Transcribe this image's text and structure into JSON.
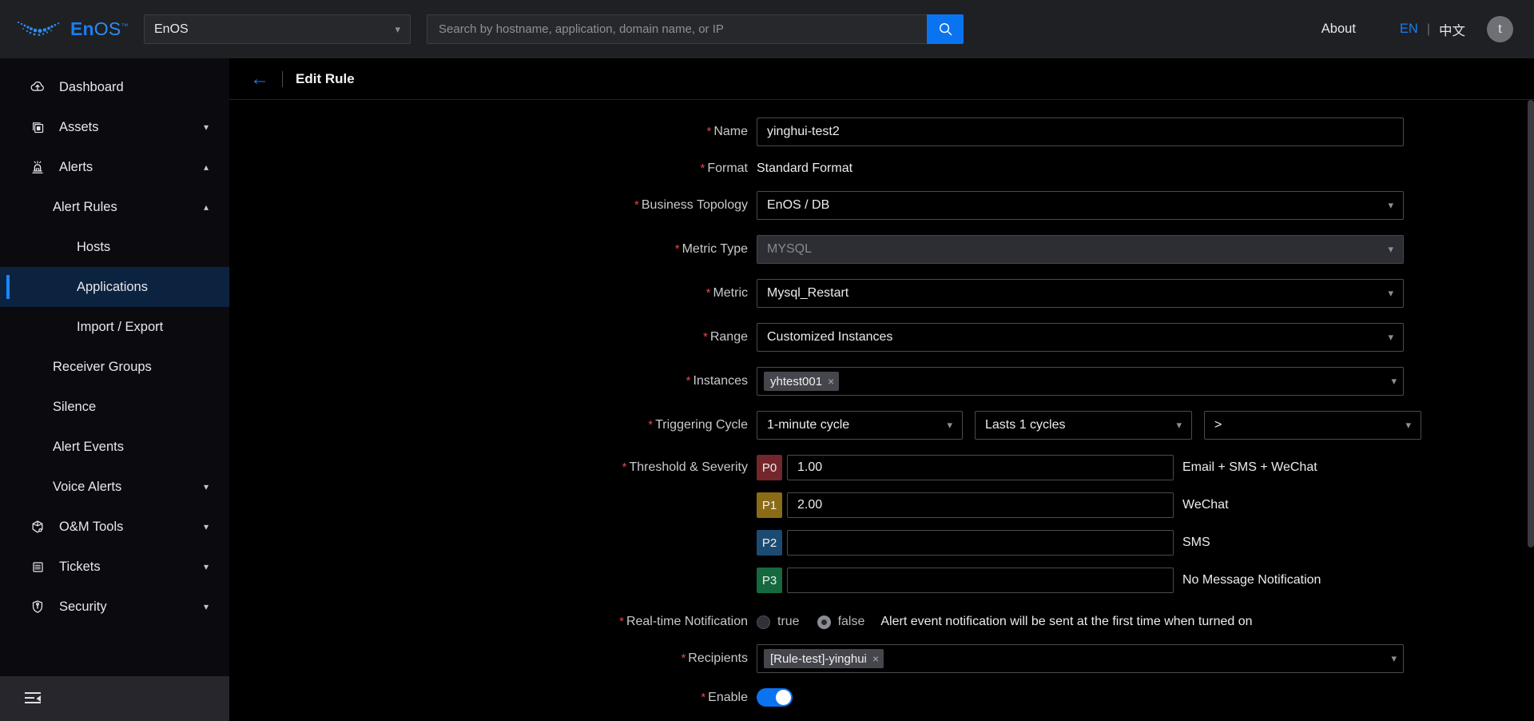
{
  "header": {
    "brand_main": "En",
    "brand_rest": "OS",
    "brand_tm": "™",
    "tenant_value": "EnOS",
    "search_placeholder": "Search by hostname, application, domain name, or IP",
    "search_value": "",
    "about_label": "About",
    "lang_en": "EN",
    "lang_separator": "|",
    "lang_cn": "中文",
    "avatar_initial": "t",
    "accent_color": "#0a74f0"
  },
  "sidebar": {
    "items": [
      {
        "label": "Dashboard",
        "icon": "cloud-dashboard-icon",
        "level": 1,
        "chevron": "",
        "active": false
      },
      {
        "label": "Assets",
        "icon": "assets-icon",
        "level": 1,
        "chevron": "˅",
        "active": false
      },
      {
        "label": "Alerts",
        "icon": "alerts-bell-icon",
        "level": 1,
        "chevron": "˄",
        "active": false
      },
      {
        "label": "Alert Rules",
        "icon": "",
        "level": 2,
        "chevron": "˄",
        "active": false
      },
      {
        "label": "Hosts",
        "icon": "",
        "level": 3,
        "chevron": "",
        "active": false
      },
      {
        "label": "Applications",
        "icon": "",
        "level": 3,
        "chevron": "",
        "active": true
      },
      {
        "label": "Import / Export",
        "icon": "",
        "level": 3,
        "chevron": "",
        "active": false
      },
      {
        "label": "Receiver Groups",
        "icon": "",
        "level": 2,
        "chevron": "",
        "active": false
      },
      {
        "label": "Silence",
        "icon": "",
        "level": 2,
        "chevron": "",
        "active": false
      },
      {
        "label": "Alert Events",
        "icon": "",
        "level": 2,
        "chevron": "",
        "active": false
      },
      {
        "label": "Voice Alerts",
        "icon": "",
        "level": 2,
        "chevron": "˅",
        "active": false
      },
      {
        "label": "O&M Tools",
        "icon": "om-tools-icon",
        "level": 1,
        "chevron": "˅",
        "active": false
      },
      {
        "label": "Tickets",
        "icon": "tickets-icon",
        "level": 1,
        "chevron": "˅",
        "active": false
      },
      {
        "label": "Security",
        "icon": "shield-icon",
        "level": 1,
        "chevron": "˅",
        "active": false
      }
    ],
    "collapse_icon": "menu-collapse-icon",
    "active_accent": "#1a87ff",
    "active_bg": "#0c2340"
  },
  "page": {
    "back_icon": "back-arrow-icon",
    "title": "Edit Rule"
  },
  "form": {
    "name": {
      "label": "Name",
      "value": "yinghui-test2",
      "required": true
    },
    "format": {
      "label": "Format",
      "value": "Standard Format",
      "required": true
    },
    "business_topology": {
      "label": "Business Topology",
      "value": "EnOS / DB",
      "required": true
    },
    "metric_type": {
      "label": "Metric Type",
      "value": "MYSQL",
      "required": true,
      "disabled": true
    },
    "metric": {
      "label": "Metric",
      "value": "Mysql_Restart",
      "required": true
    },
    "range": {
      "label": "Range",
      "value": "Customized Instances",
      "required": true
    },
    "instances": {
      "label": "Instances",
      "required": true,
      "tags": [
        "yhtest001"
      ],
      "tag_remove": "×"
    },
    "triggering_cycle": {
      "label": "Triggering Cycle",
      "required": true,
      "cycle": "1-minute cycle",
      "lasts": "Lasts 1 cycles",
      "operator": ">"
    },
    "threshold": {
      "label": "Threshold & Severity",
      "required": true,
      "levels": [
        {
          "code": "P0",
          "value": "1.00",
          "note": "Email + SMS + WeChat",
          "color": "#73262c"
        },
        {
          "code": "P1",
          "value": "2.00",
          "note": "WeChat",
          "color": "#8a6c17"
        },
        {
          "code": "P2",
          "value": "",
          "note": "SMS",
          "color": "#1b4b73"
        },
        {
          "code": "P3",
          "value": "",
          "note": "No Message Notification",
          "color": "#16693f"
        }
      ]
    },
    "realtime_notification": {
      "label": "Real-time Notification",
      "required": true,
      "option_true": "true",
      "option_false": "false",
      "selected": "false",
      "hint": "Alert event notification will be sent at the first time when turned on"
    },
    "recipients": {
      "label": "Recipients",
      "required": true,
      "tags": [
        "[Rule-test]-yinghui"
      ],
      "tag_remove": "×"
    },
    "enable": {
      "label": "Enable",
      "required": true,
      "on": true
    }
  }
}
